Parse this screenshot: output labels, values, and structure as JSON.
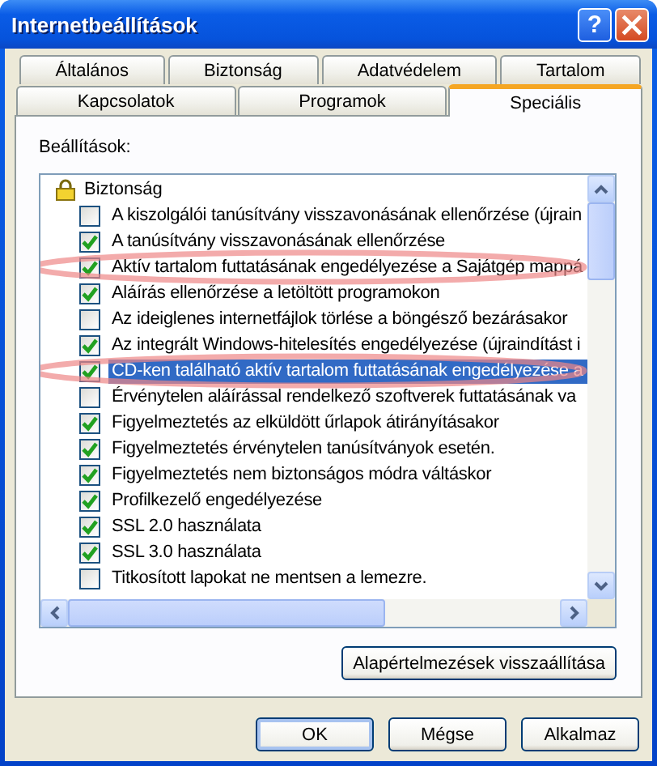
{
  "window": {
    "title": "Internetbeállítások",
    "help_button": "?"
  },
  "tab_rows": [
    [
      {
        "label": "Általános",
        "selected": false
      },
      {
        "label": "Biztonság",
        "selected": false
      },
      {
        "label": "Adatvédelem",
        "selected": false
      },
      {
        "label": "Tartalom",
        "selected": false
      }
    ],
    [
      {
        "label": "Kapcsolatok",
        "selected": false
      },
      {
        "label": "Programok",
        "selected": false
      },
      {
        "label": "Speciális",
        "selected": true
      }
    ]
  ],
  "settings": {
    "label": "Beállítások:",
    "groups": [
      {
        "title": "Biztonság",
        "children": [
          {
            "label": "A kiszolgálói tanúsítvány visszavonásának ellenőrzése (újrain",
            "checked": false,
            "selected": false,
            "highlighted": false
          },
          {
            "label": "A tanúsítvány visszavonásának ellenőrzése",
            "checked": true,
            "selected": false,
            "highlighted": false
          },
          {
            "label": "Aktív tartalom futtatásának engedélyezése a Sajátgép mappá",
            "checked": true,
            "selected": false,
            "highlighted": true
          },
          {
            "label": "Aláírás ellenőrzése a letöltött programokon",
            "checked": true,
            "selected": false,
            "highlighted": false
          },
          {
            "label": "Az ideiglenes internetfájlok törlése a böngésző bezárásakor",
            "checked": false,
            "selected": false,
            "highlighted": false
          },
          {
            "label": "Az integrált Windows-hitelesítés engedélyezése (újraindítást i",
            "checked": true,
            "selected": false,
            "highlighted": false
          },
          {
            "label": "CD-ken található aktív tartalom futtatásának engedélyezése a",
            "checked": true,
            "selected": true,
            "highlighted": true
          },
          {
            "label": "Érvénytelen aláírással rendelkező szoftverek futtatásának va",
            "checked": false,
            "selected": false,
            "highlighted": false
          },
          {
            "label": "Figyelmeztetés az elküldött űrlapok átirányításakor",
            "checked": true,
            "selected": false,
            "highlighted": false
          },
          {
            "label": "Figyelmeztetés érvénytelen tanúsítványok esetén.",
            "checked": true,
            "selected": false,
            "highlighted": false
          },
          {
            "label": "Figyelmeztetés nem biztonságos módra váltáskor",
            "checked": true,
            "selected": false,
            "highlighted": false
          },
          {
            "label": "Profilkezelő engedélyezése",
            "checked": true,
            "selected": false,
            "highlighted": false
          },
          {
            "label": "SSL 2.0 használata",
            "checked": true,
            "selected": false,
            "highlighted": false
          },
          {
            "label": "SSL 3.0 használata",
            "checked": true,
            "selected": false,
            "highlighted": false
          },
          {
            "label": "Titkosított lapokat ne mentsen a lemezre.",
            "checked": false,
            "selected": false,
            "highlighted": false
          }
        ]
      }
    ],
    "reset_button": "Alapértelmezések visszaállítása"
  },
  "buttons": [
    {
      "label": "OK",
      "default": true
    },
    {
      "label": "Mégse",
      "default": false
    },
    {
      "label": "Alkalmaz",
      "default": false
    }
  ]
}
